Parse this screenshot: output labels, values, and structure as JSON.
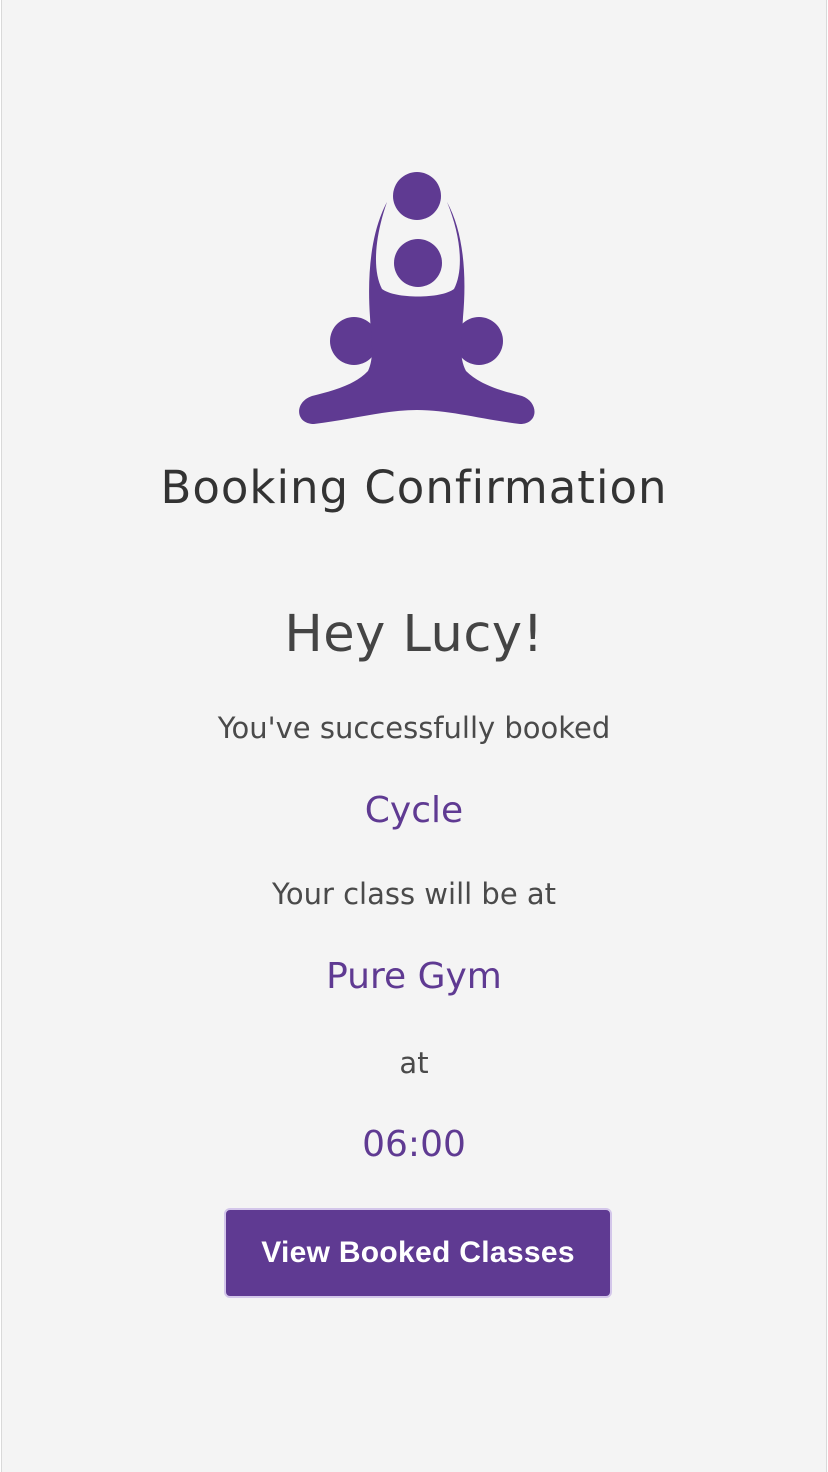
{
  "branding": {
    "logo_icon": "meditation-figure-icon",
    "accent_color": "#5f3a92"
  },
  "page": {
    "title": "Booking Confirmation"
  },
  "confirmation": {
    "greeting": "Hey Lucy!",
    "message_1": "You've successfully booked",
    "class_name": "Cycle",
    "message_2": "Your class will be at",
    "location": "Pure Gym",
    "message_3": "at",
    "time": "06:00"
  },
  "actions": {
    "view_booked_classes": "View Booked Classes"
  }
}
